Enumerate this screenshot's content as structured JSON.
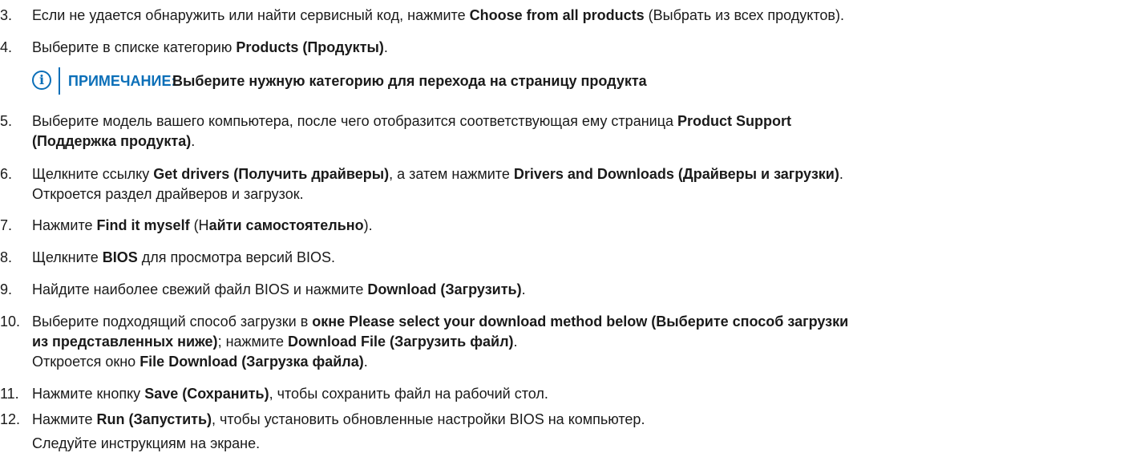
{
  "steps": [
    {
      "number": "3.",
      "parts": [
        "Если не удается обнаружить или найти сервисный код, нажмите ",
        "Choose from all products",
        " (Выбрать из всех продуктов)."
      ]
    },
    {
      "number": "4.",
      "parts": [
        "Выберите в списке категорию ",
        "Products (Продукты)",
        "."
      ]
    },
    {
      "number": "5.",
      "line1": [
        "Выберите модель вашего компьютера, после чего отобразится соответствующая ему страница ",
        "Product Support"
      ],
      "line2": [
        "(Поддержка продукта)",
        "."
      ]
    },
    {
      "number": "6.",
      "line1": [
        "Щелкните ссылку ",
        "Get drivers (Получить драйверы)",
        ", а затем нажмите ",
        "Drivers and Downloads (Драйверы и загрузки)",
        "."
      ],
      "line2": "Откроется раздел драйверов и загрузок."
    },
    {
      "number": "7.",
      "parts": [
        "Нажмите ",
        "Find it myself",
        " (Н",
        "айти самостоятельно",
        ")."
      ]
    },
    {
      "number": "8.",
      "parts": [
        "Щелкните ",
        "BIOS",
        " для просмотра версий BIOS."
      ]
    },
    {
      "number": "9.",
      "parts": [
        "Найдите наиболее свежий файл BIOS и нажмите ",
        "Download (Загрузить)",
        "."
      ]
    },
    {
      "number": "10.",
      "line1": [
        "Выберите подходящий способ загрузки в ",
        "окне Please select your download method below (Выберите способ загрузки"
      ],
      "line2": [
        "из представленных ниже)",
        "; нажмите ",
        "Download File (Загрузить файл)",
        "."
      ],
      "line3": [
        "Откроется окно ",
        "File Download (Загрузка файла)",
        "."
      ]
    },
    {
      "number": "11.",
      "parts": [
        "Нажмите кнопку ",
        "Save (Сохранить)",
        ", чтобы сохранить файл на рабочий стол."
      ]
    },
    {
      "number": "12.",
      "parts": [
        "Нажмите ",
        "Run (Запустить)",
        ", чтобы установить обновленные настройки BIOS на компьютер."
      ],
      "line2": "Следуйте инструкциям на экране."
    }
  ],
  "note": {
    "icon": "info-icon",
    "icon_glyph": "i",
    "label": "ПРИМЕЧАНИЕ:",
    "text": "Выберите нужную категорию для перехода на страницу продукта"
  },
  "colors": {
    "accent": "#0b6fb8",
    "text": "#1a1a1a"
  }
}
